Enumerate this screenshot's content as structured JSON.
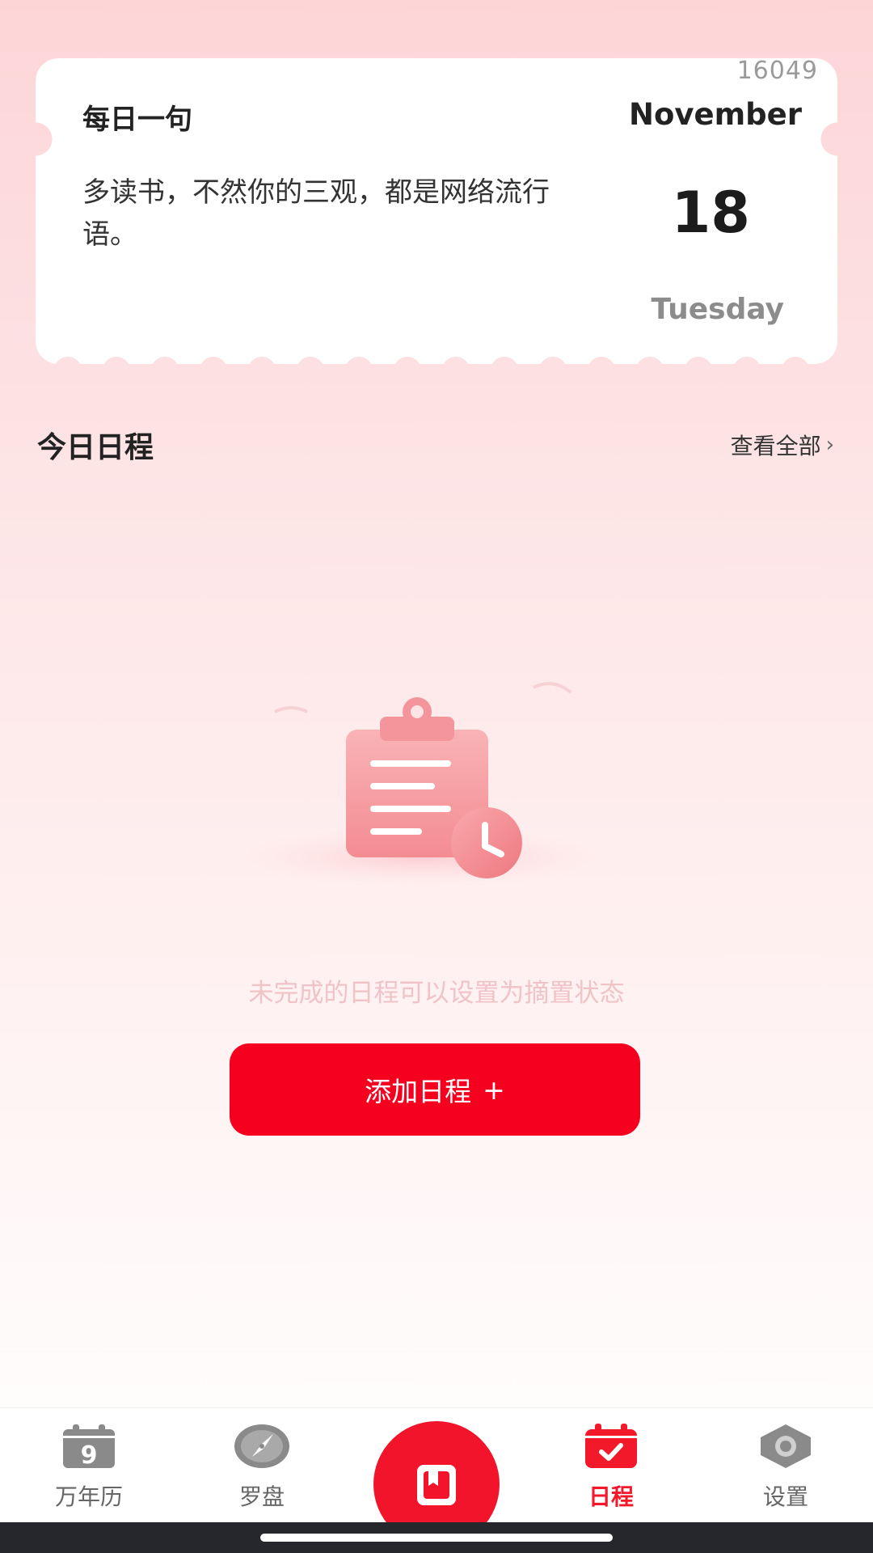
{
  "quote_card": {
    "counter": "16049",
    "title": "每日一句",
    "text": "多读书，不然你的三观，都是网络流行语。",
    "month": "November",
    "day": "18",
    "weekday": "Tuesday"
  },
  "schedule": {
    "section_title": "今日日程",
    "view_all_label": "查看全部",
    "view_all_chevron": "›",
    "empty_hint": "未完成的日程可以设置为摘置状态",
    "add_button_label": "添加日程",
    "add_button_plus": "+"
  },
  "bottom_nav": {
    "items": [
      {
        "label": "万年历",
        "icon": "calendar-9-icon",
        "active": false
      },
      {
        "label": "罗盘",
        "icon": "compass-icon",
        "active": false
      },
      {
        "label": "",
        "icon": "book-icon",
        "active": false
      },
      {
        "label": "日程",
        "icon": "calendar-check-icon",
        "active": true
      },
      {
        "label": "设置",
        "icon": "hex-nut-settings-icon",
        "active": false
      }
    ],
    "calendar_icon_digit": "9"
  },
  "colors": {
    "accent": "#f5001e",
    "active_tab": "#f1192a",
    "inactive_icon": "#8a8a8a",
    "hint_text": "#f0c3c6"
  }
}
